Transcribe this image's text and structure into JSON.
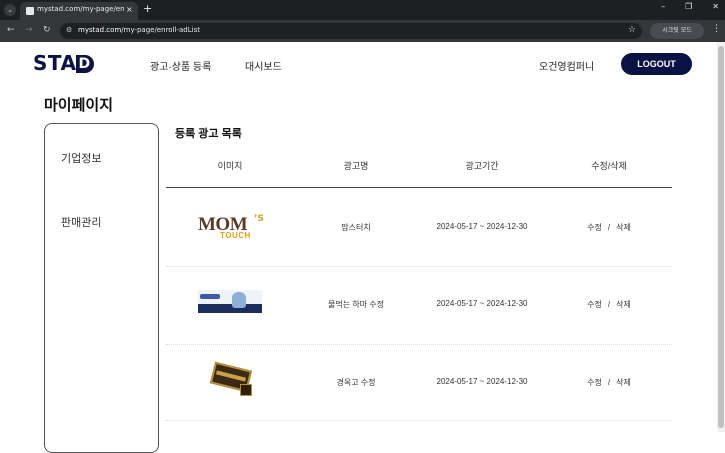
{
  "browser": {
    "tab_title": "mystad.com/my-page/enroll-",
    "tab_close": "×",
    "new_tab": "+",
    "tab_menu_icon": "⌄",
    "url_host": "mystad.com",
    "url_path": "/my-page/enroll-adList",
    "bookmarks_label": "시크릿 모드",
    "win_minimize": "–",
    "win_restore": "❐",
    "win_close": "✕"
  },
  "header": {
    "logo": "STA",
    "logo_d": "D",
    "nav": [
      "광고·상품 등록",
      "대시보드"
    ],
    "company": "오건영컴퍼니",
    "logout": "LOGOUT"
  },
  "page_title": "마이페이지",
  "sidebar": {
    "items": [
      "기업정보",
      "판매관리"
    ]
  },
  "list": {
    "title": "등록 광고 목록",
    "columns": [
      "이미지",
      "광고명",
      "광고기간",
      "수정/삭제"
    ],
    "rows": [
      {
        "thumb": "MOM'S TOUCH",
        "name": "맘스터치",
        "period": "2024-05-17 ~ 2024-12-30",
        "edit": "수정",
        "sep": "/",
        "del": "삭제"
      },
      {
        "thumb": "",
        "name": "물먹는 하마 수정",
        "period": "2024-05-17 ~ 2024-12-30",
        "edit": "수정",
        "sep": "/",
        "del": "삭제"
      },
      {
        "thumb": "",
        "name": "경옥고 수정",
        "period": "2024-05-17 ~ 2024-12-30",
        "edit": "수정",
        "sep": "/",
        "del": "삭제"
      }
    ]
  },
  "moms_thumb": {
    "main": "MOM",
    "apos": "’S",
    "sub": "TOUCH"
  },
  "colors": {
    "brand": "#0a1344",
    "chrome_dark": "#1e1f22",
    "chrome_toolbar": "#35363a"
  }
}
